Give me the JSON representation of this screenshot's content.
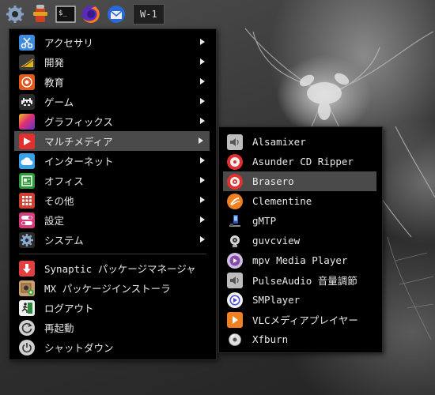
{
  "panel": {
    "launchers": [
      {
        "icon": "settings-gear-icon"
      },
      {
        "icon": "fire-hydrant-icon"
      },
      {
        "icon": "terminal-icon",
        "label": "$_"
      },
      {
        "icon": "firefox-icon"
      },
      {
        "icon": "thunderbird-mail-icon"
      }
    ],
    "workspace_label": "W-1"
  },
  "main_menu": {
    "items": [
      {
        "label": "アクセサリ",
        "icon": "accessories-scissors-icon",
        "color": "#3d8be0",
        "submenu": true
      },
      {
        "label": "開発",
        "icon": "development-icon",
        "color": "#e0b21a",
        "submenu": true
      },
      {
        "label": "教育",
        "icon": "education-icon",
        "color": "#e05a20",
        "submenu": true
      },
      {
        "label": "ゲーム",
        "icon": "games-invader-icon",
        "color": "#333333",
        "submenu": true
      },
      {
        "label": "グラフィックス",
        "icon": "graphics-icon",
        "color": "#a040c0",
        "submenu": true
      },
      {
        "label": "マルチメディア",
        "icon": "multimedia-play-icon",
        "color": "#e03030",
        "submenu": true,
        "active": true
      },
      {
        "label": "インターネット",
        "icon": "internet-cloud-icon",
        "color": "#3aa0e8",
        "submenu": true
      },
      {
        "label": "オフィス",
        "icon": "office-icon",
        "color": "#2e9a3a",
        "submenu": true
      },
      {
        "label": "その他",
        "icon": "other-grid-icon",
        "color": "#d04030",
        "submenu": true
      },
      {
        "label": "設定",
        "icon": "settings-toggle-icon",
        "color": "#d83a7a",
        "submenu": true
      },
      {
        "label": "システム",
        "icon": "system-gear-icon",
        "color": "#6a88b0",
        "submenu": true
      }
    ],
    "extra_items": [
      {
        "label": "Synaptic パッケージマネージャ",
        "icon": "synaptic-download-icon",
        "color": "#e04040"
      },
      {
        "label": "MX パッケージインストーラ",
        "icon": "mx-package-installer-icon",
        "color": "#c08040"
      },
      {
        "label": "ログアウト",
        "icon": "logout-runner-icon",
        "color": "#f0f0f0"
      },
      {
        "label": "再起動",
        "icon": "reboot-icon",
        "color": "#d0d0d0"
      },
      {
        "label": "シャットダウン",
        "icon": "shutdown-power-icon",
        "color": "#d0d0d0"
      }
    ]
  },
  "multimedia_submenu": {
    "items": [
      {
        "label": "Alsamixer",
        "icon": "alsamixer-speaker-icon",
        "color": "#bdbdbd"
      },
      {
        "label": "Asunder CD Ripper",
        "icon": "asunder-cd-icon",
        "color": "#e03030"
      },
      {
        "label": "Brasero",
        "icon": "brasero-disc-icon",
        "color": "#e03030",
        "active": true
      },
      {
        "label": "Clementine",
        "icon": "clementine-icon",
        "color": "#f08020"
      },
      {
        "label": "gMTP",
        "icon": "gmtp-device-icon",
        "color": "#3a7ad8"
      },
      {
        "label": "guvcview",
        "icon": "guvcview-webcam-icon",
        "color": "#d0d0d0"
      },
      {
        "label": "mpv Media Player",
        "icon": "mpv-player-icon",
        "color": "#8a4aa8"
      },
      {
        "label": "PulseAudio 音量調節",
        "icon": "pulseaudio-speaker-icon",
        "color": "#bdbdbd"
      },
      {
        "label": "SMPlayer",
        "icon": "smplayer-icon",
        "color": "#4a4ad8"
      },
      {
        "label": "VLCメディアプレイヤー",
        "icon": "vlc-cone-icon",
        "color": "#f08020"
      },
      {
        "label": "Xfburn",
        "icon": "xfburn-disc-icon",
        "color": "#d0d0d0"
      }
    ]
  }
}
